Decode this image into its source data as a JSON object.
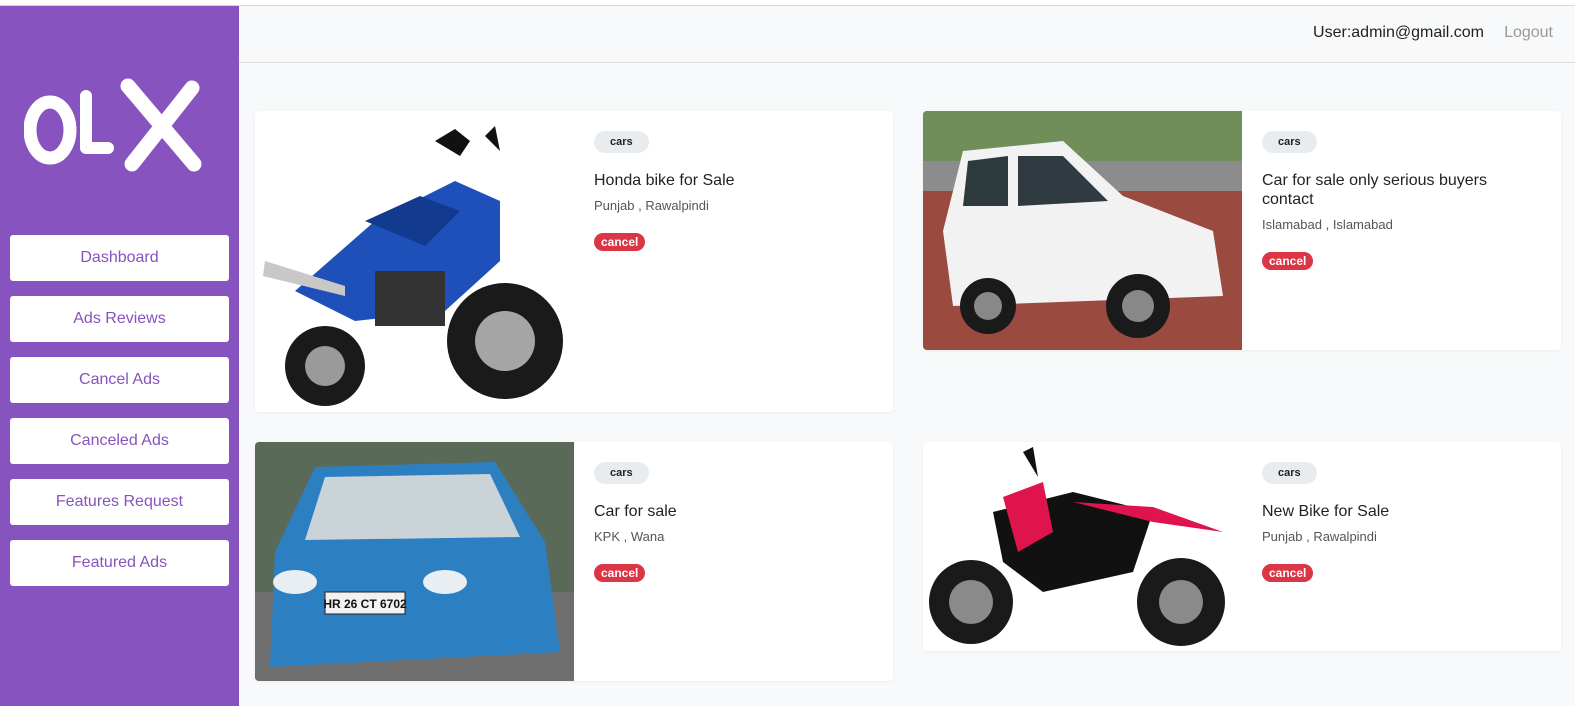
{
  "brand": {
    "logo_text": "OLX",
    "color": "#8753bf"
  },
  "sidebar": {
    "items": [
      {
        "label": "Dashboard"
      },
      {
        "label": "Ads Reviews"
      },
      {
        "label": "Cancel Ads"
      },
      {
        "label": "Canceled Ads"
      },
      {
        "label": "Features Request"
      },
      {
        "label": "Featured Ads"
      }
    ]
  },
  "header": {
    "user": "User:admin@gmail.com",
    "logout": "Logout"
  },
  "ads": [
    {
      "category": "cars",
      "title": "Honda bike for Sale",
      "location": "Punjab , Rawalpindi",
      "action": "cancel"
    },
    {
      "category": "cars",
      "title": "Car for sale only serious buyers contact",
      "location": "Islamabad , Islamabad",
      "action": "cancel"
    },
    {
      "category": "cars",
      "title": "Car for sale",
      "location": "KPK , Wana",
      "action": "cancel"
    },
    {
      "category": "cars",
      "title": "New Bike for Sale",
      "location": "Punjab , Rawalpindi",
      "action": "cancel"
    }
  ]
}
